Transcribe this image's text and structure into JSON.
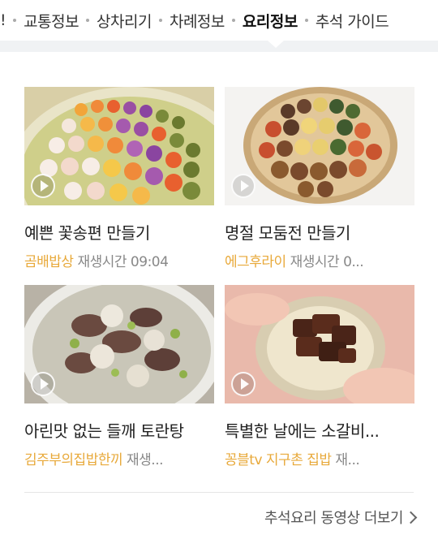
{
  "nav": {
    "items": [
      {
        "label": "!"
      },
      {
        "label": "교통정보"
      },
      {
        "label": "상차리기"
      },
      {
        "label": "차례정보"
      },
      {
        "label": "요리정보",
        "active": true
      },
      {
        "label": "추석 가이드"
      }
    ]
  },
  "cards": [
    {
      "title": "예쁜 꽃송편 만들기",
      "source": "곰배밥상",
      "duration": "재생시간 09:04"
    },
    {
      "title": "명절 모둠전 만들기",
      "source": "에그후라이",
      "duration": "재생시간 0..."
    },
    {
      "title": "아린맛 없는 들깨 토란탕",
      "source": "김주부의집밥한끼",
      "duration": "재생..."
    },
    {
      "title": "특별한 날에는 소갈비...",
      "source": "꽁블tv 지구촌 집밥",
      "duration": "재..."
    }
  ],
  "more": {
    "label": "추석요리 동영상 더보기"
  },
  "colors": {
    "source": "#e8a93a",
    "band": "#f0f2f4"
  }
}
